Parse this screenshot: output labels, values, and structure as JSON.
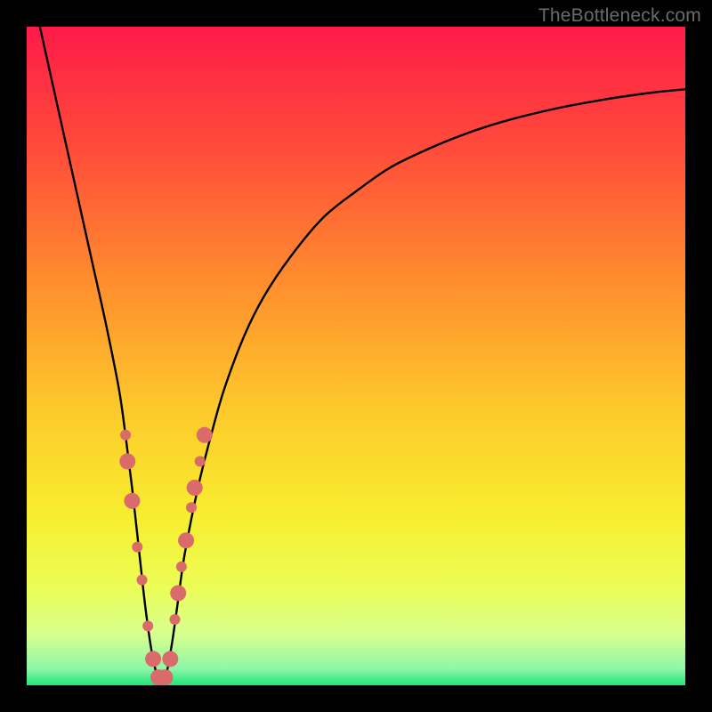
{
  "watermark": "TheBottleneck.com",
  "chart_data": {
    "type": "line",
    "title": "",
    "xlabel": "",
    "ylabel": "",
    "xlim": [
      0,
      100
    ],
    "ylim": [
      0,
      100
    ],
    "grid": false,
    "legend": false,
    "series": [
      {
        "name": "bottleneck-curve",
        "x": [
          2,
          4,
          6,
          8,
          10,
          12,
          14,
          15,
          16,
          17,
          18,
          19,
          20,
          21,
          22,
          23,
          24,
          26,
          28,
          30,
          33,
          36,
          40,
          45,
          50,
          55,
          60,
          66,
          72,
          80,
          88,
          95,
          100
        ],
        "y": [
          100,
          91,
          82,
          73,
          64,
          55,
          45,
          38,
          30,
          21,
          12,
          5,
          1,
          1,
          6,
          13,
          20,
          30,
          38,
          45,
          53,
          59,
          65,
          71,
          75,
          78.5,
          81,
          83.5,
          85.5,
          87.5,
          89,
          90,
          90.5
        ]
      }
    ],
    "markers": {
      "name": "highlight-points",
      "color": "#d96b6b",
      "radius_small": 6,
      "radius_large": 9,
      "points": [
        {
          "x": 15.0,
          "y": 38,
          "r": "small"
        },
        {
          "x": 15.3,
          "y": 34,
          "r": "large"
        },
        {
          "x": 16.0,
          "y": 28,
          "r": "large"
        },
        {
          "x": 16.8,
          "y": 21,
          "r": "small"
        },
        {
          "x": 17.5,
          "y": 16,
          "r": "small"
        },
        {
          "x": 18.4,
          "y": 9,
          "r": "small"
        },
        {
          "x": 19.2,
          "y": 4,
          "r": "large"
        },
        {
          "x": 20.0,
          "y": 1.2,
          "r": "large"
        },
        {
          "x": 21.0,
          "y": 1.2,
          "r": "large"
        },
        {
          "x": 21.8,
          "y": 4,
          "r": "large"
        },
        {
          "x": 22.5,
          "y": 10,
          "r": "small"
        },
        {
          "x": 23.0,
          "y": 14,
          "r": "large"
        },
        {
          "x": 23.5,
          "y": 18,
          "r": "small"
        },
        {
          "x": 24.2,
          "y": 22,
          "r": "large"
        },
        {
          "x": 25.0,
          "y": 27,
          "r": "small"
        },
        {
          "x": 25.5,
          "y": 30,
          "r": "large"
        },
        {
          "x": 26.3,
          "y": 34,
          "r": "small"
        },
        {
          "x": 27.0,
          "y": 38,
          "r": "large"
        }
      ]
    },
    "background_gradient": {
      "stops": [
        {
          "offset": 0.0,
          "color": "#fe1b49"
        },
        {
          "offset": 0.18,
          "color": "#ff4a3a"
        },
        {
          "offset": 0.38,
          "color": "#ff8b2e"
        },
        {
          "offset": 0.58,
          "color": "#fdc92b"
        },
        {
          "offset": 0.74,
          "color": "#f7ed2e"
        },
        {
          "offset": 0.85,
          "color": "#ecfd55"
        },
        {
          "offset": 0.925,
          "color": "#d6ff90"
        },
        {
          "offset": 0.975,
          "color": "#8cf7a8"
        },
        {
          "offset": 1.0,
          "color": "#20e578"
        }
      ]
    }
  }
}
